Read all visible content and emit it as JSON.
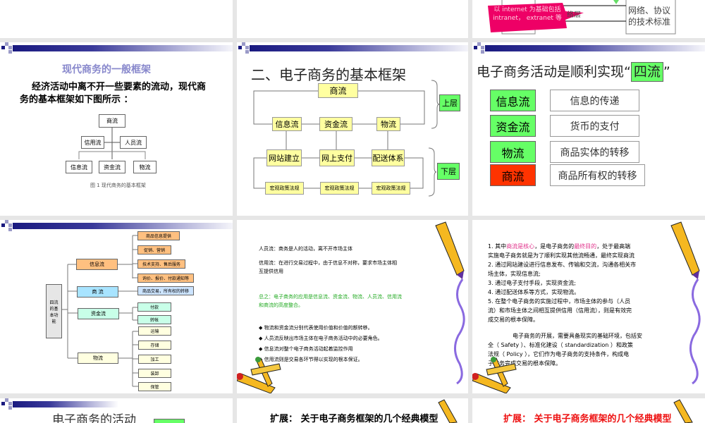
{
  "top_row": {
    "callout": "以 internet 为基础包括 intranet， extranet 等",
    "net_layer": "络层",
    "right_box": [
      "网络、协议",
      "的技术标准"
    ]
  },
  "slide1": {
    "title": "现代商务的一般框架",
    "body": [
      "经济活动中离不开一些要素的流动，现代商",
      "务的基本框架如下图所示 ："
    ],
    "boxes": {
      "top": "商流",
      "credit": "信用流",
      "people": "人员流",
      "info": "信息流",
      "fund": "资金流",
      "logistics": "物流"
    },
    "caption": "图 1 现代商务的基本框架"
  },
  "slide2": {
    "title": "二、电子商务的基本框架",
    "commerce": "商流",
    "info": "信息流",
    "fund": "资金流",
    "logistics": "物流",
    "website": "网站建立",
    "payment": "网上支付",
    "delivery": "配送体系",
    "policy": "宏观政策法规",
    "upper": "上层",
    "lower": "下层"
  },
  "slide3": {
    "title": "电子商务活动是顺利实现“",
    "title_highlight": "四流",
    "title_end": "”",
    "flows": [
      {
        "name": "信息流",
        "desc": "信息的传递",
        "color": "#66ff66"
      },
      {
        "name": "资金流",
        "desc": "货币的支付",
        "color": "#66ff66"
      },
      {
        "name": "物流",
        "desc": "商品实体的转移",
        "color": "#66ff66"
      },
      {
        "name": "商流",
        "desc": "商品所有权的转移",
        "color": "#ff3300"
      }
    ]
  },
  "slide4": {
    "root": "四流的基本功能",
    "info": "信息流",
    "info_items": [
      "商品信息提供",
      "促销、营销",
      "技术支持、售后服务",
      "询价、报价、付款通知等"
    ],
    "commerce": "商 流",
    "commerce_item": "商品交易，所有权的转移",
    "fund": "资金流",
    "fund_items": [
      "付款",
      "转帐"
    ],
    "logistics": "物流",
    "logistics_items": [
      "运输",
      "存储",
      "加工",
      "装卸",
      "保管"
    ]
  },
  "slide5": {
    "people": "人员流：商务是人的活动，离不开市场主体",
    "credit": [
      "信用流：在进行交易过程中，由于信息不对称，要求市场主体相",
      "互提供信用"
    ],
    "summary": [
      "总之：电子商务的应用是信息流、资金流、物流、人员流、信用流",
      "和商流的高度整合。"
    ],
    "bullets": [
      "物流和资金流分别代表使用价值和价值的额转移。",
      "人员流反映出市场主体在电子商务活动中的必要角色。",
      "信息流对整个电子商务活动起着监控作用",
      "信用流则是交易各环节得以实现的根本保证。"
    ]
  },
  "slide6": {
    "l1a": "1. 其中",
    "l1b": "商流是核心",
    "l1c": "，是电子商务的",
    "l1d": "最终目的",
    "l1e": "，处于最高端",
    "lines": [
      "实施电子商务就是为了顺利实现其他流畅通，最终实现商流",
      "2. 通过网站建设进行信息发布、传输和交流，沟通各相关市",
      "场主体，实现信息流;",
      "3. 通过电子支付手段，实现资金流;",
      "4. 通过配送体系等方式，实现物流。",
      "5. 在整个电子商务的实施过程中，市场主体的参与（人员",
      "流）和市场主体之间相互提供信用（信用流），则是有效完",
      "成交易的根本保障。"
    ],
    "para": [
      "电子商务的开展，需要具备现实的基础环境，包括安",
      "全（ Safety ）、标准化建设（ standardization ）和政策",
      "法规（ Policy ），它们作为电子商务的支持条件，构成电",
      "子商务完成交易的根本保障。"
    ]
  },
  "slide7": {
    "title": "电子商务的活动"
  },
  "slide8": {
    "title": "扩展： 关于电子商务框架的几个经典模型"
  },
  "slide9": {
    "title": "扩展： 关于电子商务框架的几个经典模型"
  }
}
